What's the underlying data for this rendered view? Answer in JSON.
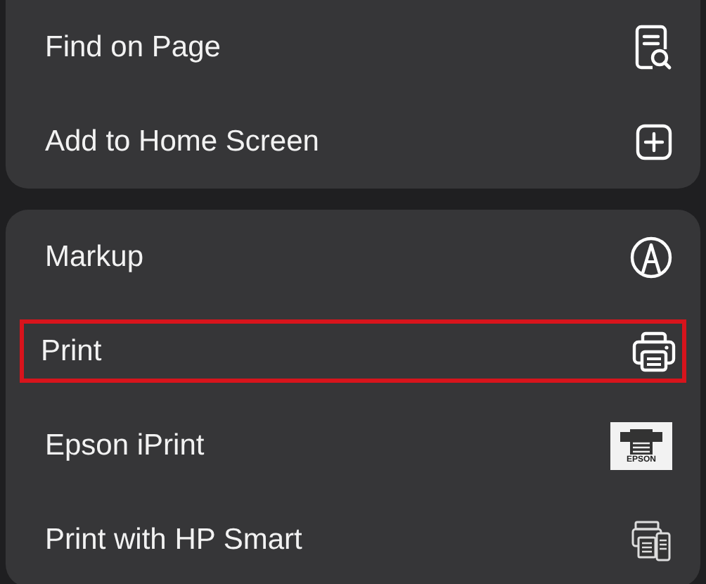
{
  "groups": [
    {
      "items": [
        {
          "label": "Find on Page",
          "kind": "find",
          "highlighted": false
        },
        {
          "label": "Add to Home Screen",
          "kind": "add",
          "highlighted": false
        }
      ]
    },
    {
      "items": [
        {
          "label": "Markup",
          "kind": "markup",
          "highlighted": false
        },
        {
          "label": "Print",
          "kind": "print",
          "highlighted": true
        },
        {
          "label": "Epson iPrint",
          "kind": "epson",
          "icon_text": "EPSON",
          "highlighted": false
        },
        {
          "label": "Print with HP Smart",
          "kind": "hp",
          "highlighted": false
        }
      ]
    }
  ]
}
